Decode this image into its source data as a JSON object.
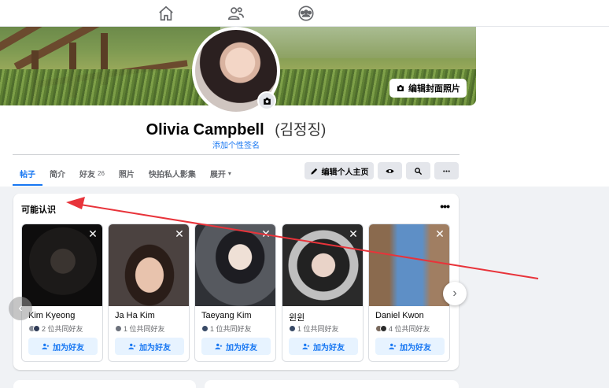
{
  "topbar": {
    "icons": [
      "home-icon",
      "friends-icon",
      "groups-icon"
    ]
  },
  "profile": {
    "edit_cover_label": "编辑封面照片",
    "name": "Olivia Campbell",
    "alt_name": "(김정징)",
    "add_bio_label": "添加个性签名"
  },
  "tabs": [
    {
      "label": "帖子",
      "active": true
    },
    {
      "label": "简介"
    },
    {
      "label": "好友",
      "count": "26"
    },
    {
      "label": "照片"
    },
    {
      "label": "快拍私人影集"
    },
    {
      "label": "展开",
      "caret": "▾"
    }
  ],
  "actions": {
    "edit_profile_label": "编辑个人主页"
  },
  "pymk": {
    "title": "可能认识",
    "more": "•••",
    "add_label": "加为好友",
    "cards": [
      {
        "name": "Kim Kyeong",
        "mutual": "2 位共同好友"
      },
      {
        "name": "Ja Ha Kim",
        "mutual": "1 位共同好友"
      },
      {
        "name": "Taeyang Kim",
        "mutual": "1 位共同好友"
      },
      {
        "name": "윈윈",
        "mutual": "1 位共同好友"
      },
      {
        "name": "Daniel Kwon",
        "mutual": "4 位共同好友"
      }
    ]
  },
  "colors": {
    "accent": "#1877f2",
    "annotation_arrow": "#e8333a"
  }
}
